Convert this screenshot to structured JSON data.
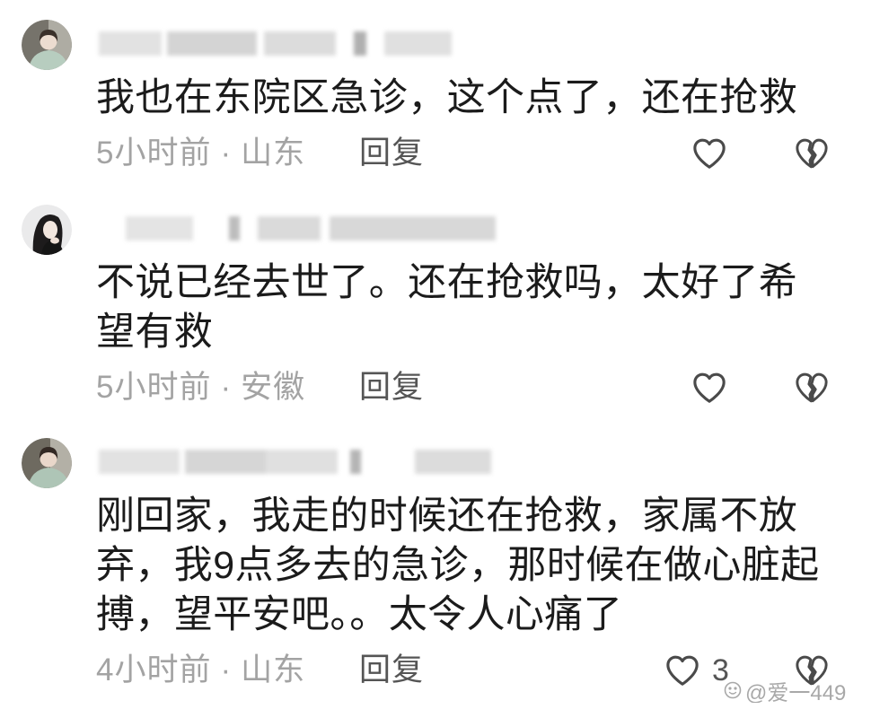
{
  "comments": [
    {
      "text_lines": [
        "我也在东院区急诊，这个点了，还在抢救"
      ],
      "time": "5小时前",
      "separator": "·",
      "location": "山东",
      "reply_label": "回复",
      "like_icon": "heart-outline-icon",
      "dislike_icon": "broken-heart-icon"
    },
    {
      "text_lines": [
        "不说已经去世了。还在抢救吗，太好了希",
        "望有救"
      ],
      "time": "5小时前",
      "separator": "·",
      "location": "安徽",
      "reply_label": "回复",
      "like_icon": "heart-outline-icon",
      "dislike_icon": "broken-heart-icon"
    },
    {
      "text_lines": [
        "刚回家，我走的时候还在抢救，家属不放",
        "弃，我9点多去的急诊，那时候在做心脏起",
        "搏，望平安吧。。太令人心痛了"
      ],
      "time": "4小时前",
      "separator": "·",
      "location": "山东",
      "reply_label": "回复",
      "like_count": "3",
      "like_icon": "heart-outline-icon",
      "dislike_icon": "broken-heart-icon"
    }
  ],
  "watermark": {
    "text": "@爱一449",
    "icon": "watermark-logo-icon"
  },
  "colors": {
    "text": "#1b1b1b",
    "meta": "#a3a3a3",
    "reply": "#555555",
    "icon": "#4a4a4a",
    "watermark": "#9a9a9a"
  }
}
